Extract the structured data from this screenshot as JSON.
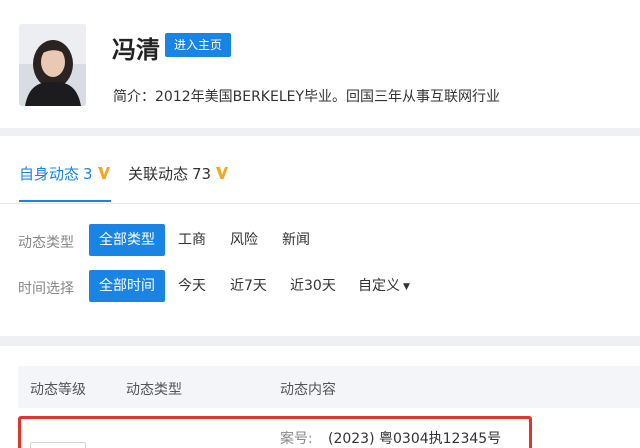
{
  "profile": {
    "name": "冯清",
    "homepage_button": "进入主页",
    "intro": "简介：2012年美国BERKELEY毕业。回国三年从事互联网行业"
  },
  "tabs": [
    {
      "label": "自身动态",
      "count": "3",
      "active": true
    },
    {
      "label": "关联动态",
      "count": "73",
      "active": false
    }
  ],
  "filters": {
    "type": {
      "label": "动态类型",
      "options": [
        "全部类型",
        "工商",
        "风险",
        "新闻"
      ],
      "selected": "全部类型"
    },
    "time": {
      "label": "时间选择",
      "options": [
        "全部时间",
        "今天",
        "近7天",
        "近30天",
        "自定义"
      ],
      "selected": "全部时间"
    }
  },
  "table": {
    "columns": [
      "动态等级",
      "动态类型",
      "动态内容"
    ],
    "rows": [
      {
        "content_label": "案号:",
        "content_value": "(2023) 粤0304执12345号"
      }
    ]
  },
  "colors": {
    "accent": "#1a84e4",
    "vip": "#f5a623",
    "highlight_border": "#e0342e"
  }
}
